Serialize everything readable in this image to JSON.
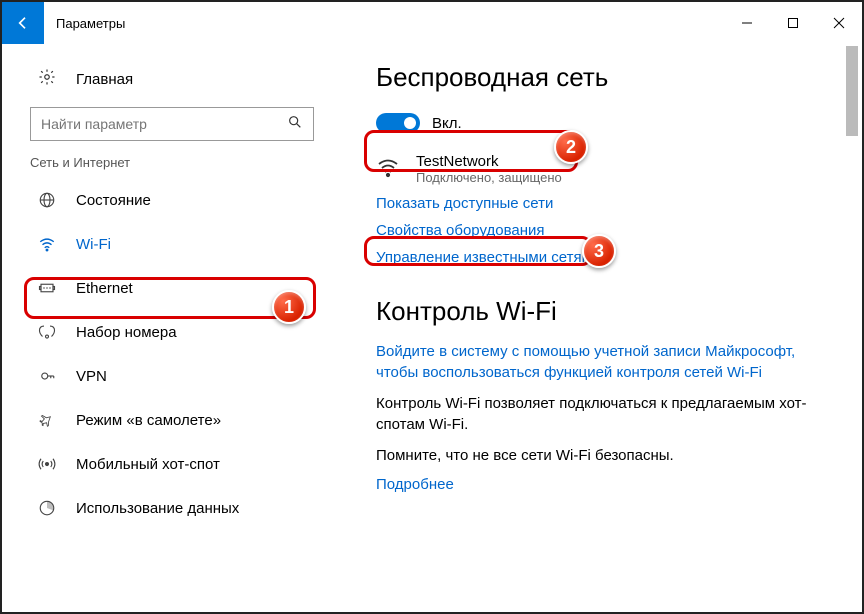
{
  "titlebar": {
    "title": "Параметры"
  },
  "sidebar": {
    "home": "Главная",
    "search_placeholder": "Найти параметр",
    "category": "Сеть и Интернет",
    "items": [
      {
        "label": "Состояние"
      },
      {
        "label": "Wi-Fi"
      },
      {
        "label": "Ethernet"
      },
      {
        "label": "Набор номера"
      },
      {
        "label": "VPN"
      },
      {
        "label": "Режим «в самолете»"
      },
      {
        "label": "Мобильный хот-спот"
      },
      {
        "label": "Использование данных"
      }
    ]
  },
  "content": {
    "wireless_heading": "Беспроводная сеть",
    "toggle_label": "Вкл.",
    "network_name": "TestNetwork",
    "network_status": "Подключено, защищено",
    "link_show_networks": "Показать доступные сети",
    "link_hw_props": "Свойства оборудования",
    "link_known_networks": "Управление известными сетями",
    "wifi_control_heading": "Контроль Wi-Fi",
    "signin_link": "Войдите в систему с помощью учетной записи Майкрософт, чтобы воспользоваться функцией контроля сетей Wi-Fi",
    "para1": "Контроль Wi-Fi позволяет подключаться к предлагаемым хот-спотам Wi-Fi.",
    "para2": "Помните, что не все сети Wi-Fi безопасны.",
    "link_more": "Подробнее"
  },
  "badges": {
    "b1": "1",
    "b2": "2",
    "b3": "3"
  }
}
